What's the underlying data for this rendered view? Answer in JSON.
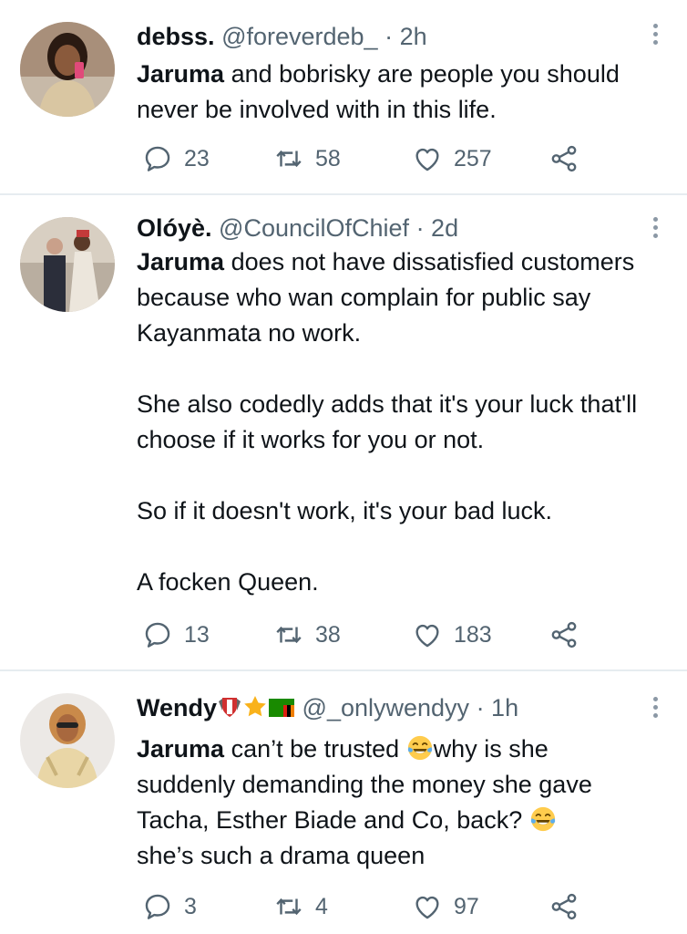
{
  "tweets": [
    {
      "name": "debss.",
      "handle": "@foreverdeb_",
      "time": "· 2h",
      "text_lead": "Jaruma",
      "text_rest": " and bobrisky are people you should never be involved with in this life.",
      "replies": "23",
      "retweets": "58",
      "likes": "257"
    },
    {
      "name": "Olóyè.",
      "handle": "@CouncilOfChief",
      "time": "· 2d",
      "text_lead": "Jaruma",
      "text_rest": " does not have dissatisfied customers because who wan complain for public say Kayanmata no work.",
      "para2": "She also codedly adds that it's your luck that'll choose if it works for you or not.",
      "para3": "So if it doesn't work, it's your bad luck.",
      "para4": "A focken Queen.",
      "replies": "13",
      "retweets": "38",
      "likes": "183"
    },
    {
      "name": "Wendy",
      "handle": "@_onlywendyy",
      "time": "· 1h",
      "text_lead": "Jaruma",
      "text_part1": " can’t be trusted ",
      "text_part2": "why is she suddenly demanding the money she gave Tacha, Esther Biade and Co, back? ",
      "text_part3": "she’s such a drama queen",
      "replies": "3",
      "retweets": "4",
      "likes": "97"
    }
  ],
  "icons": {
    "reply": "reply-icon",
    "retweet": "retweet-icon",
    "like": "heart-icon",
    "share": "share-icon",
    "more": "more-options-icon",
    "emoji": "tears-of-joy-emoji"
  },
  "colors": {
    "text": "#0f1419",
    "meta": "#536471",
    "divider": "#e6ecf0"
  }
}
